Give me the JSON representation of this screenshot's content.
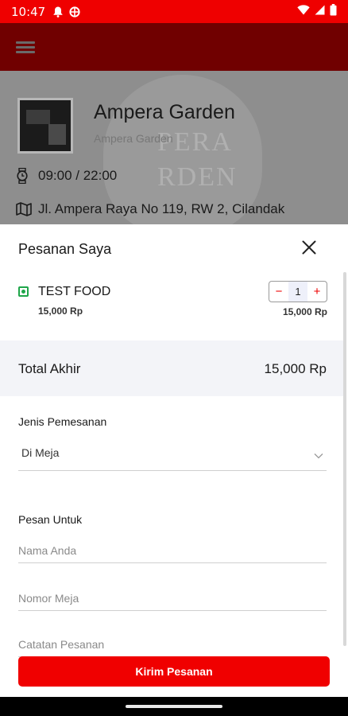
{
  "status_bar": {
    "time": "10:47"
  },
  "background": {
    "shop_name": "Ampera Garden",
    "shop_subtitle": "Ampera Garden",
    "watermark_text": "PERA\nRDEN",
    "hours": "09:00 / 22:00",
    "address": "Jl. Ampera Raya No 119, RW 2, Cilandak"
  },
  "sheet": {
    "title": "Pesanan Saya",
    "items": [
      {
        "name": "TEST FOOD",
        "price": "15,000 Rp",
        "quantity": "1",
        "line_total": "15,000 Rp"
      }
    ],
    "stepper": {
      "minus": "−",
      "plus": "+"
    },
    "total_label": "Total Akhir",
    "total_value": "15,000 Rp",
    "order_type": {
      "label": "Jenis Pemesanan",
      "selected": "Di Meja"
    },
    "order_for": {
      "label": "Pesan Untuk",
      "name_placeholder": "Nama Anda",
      "table_placeholder": "Nomor Meja",
      "note_placeholder": "Catatan Pesanan"
    },
    "submit_label": "Kirim Pesanan"
  },
  "colors": {
    "primary": "#f00000",
    "status_bar": "#ef0000",
    "veg_green": "#1fa64a"
  }
}
